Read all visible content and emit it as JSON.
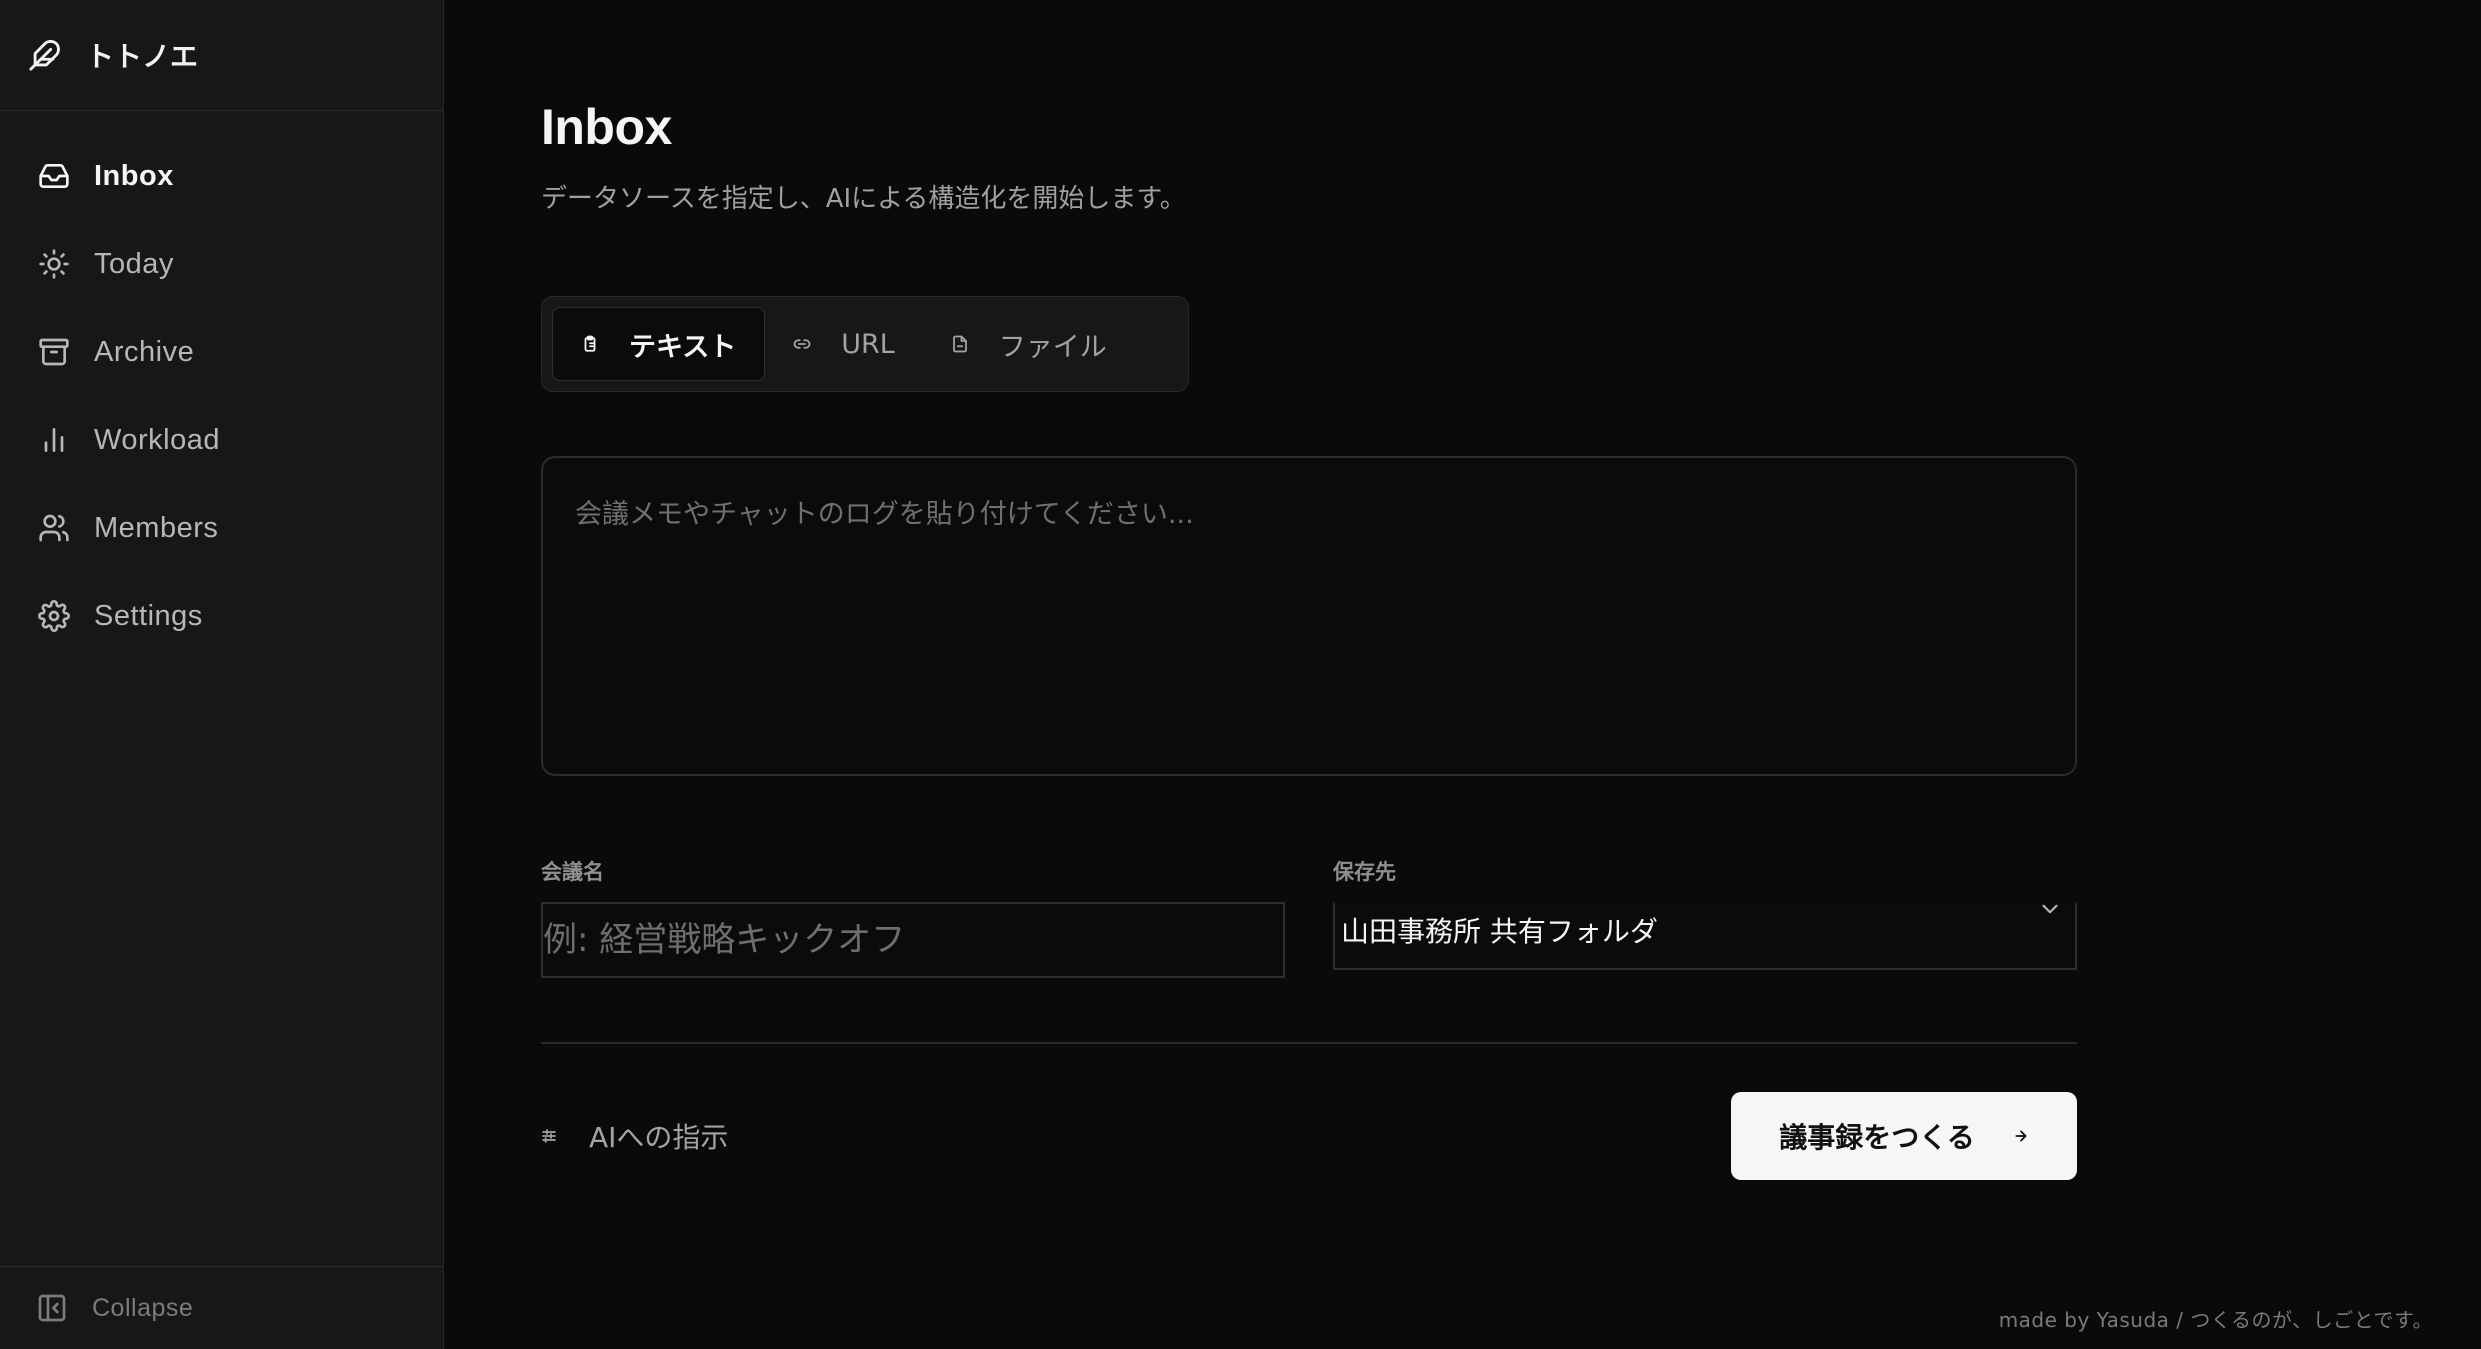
{
  "app": {
    "name": "トトノエ"
  },
  "sidebar": {
    "items": [
      {
        "label": "Inbox",
        "icon": "inbox-icon",
        "active": true
      },
      {
        "label": "Today",
        "icon": "sun-icon",
        "active": false
      },
      {
        "label": "Archive",
        "icon": "archive-icon",
        "active": false
      },
      {
        "label": "Workload",
        "icon": "bar-chart-icon",
        "active": false
      },
      {
        "label": "Members",
        "icon": "users-icon",
        "active": false
      },
      {
        "label": "Settings",
        "icon": "gear-icon",
        "active": false
      }
    ],
    "collapse_label": "Collapse"
  },
  "page": {
    "title": "Inbox",
    "subtitle": "データソースを指定し、AIによる構造化を開始します。"
  },
  "source_tabs": [
    {
      "label": "テキスト",
      "icon": "clipboard-icon",
      "active": true
    },
    {
      "label": "URL",
      "icon": "link-icon",
      "active": false
    },
    {
      "label": "ファイル",
      "icon": "file-icon",
      "active": false
    }
  ],
  "input": {
    "placeholder": "会議メモやチャットのログを貼り付けてください...",
    "value": ""
  },
  "meeting": {
    "label": "会議名",
    "placeholder": "例: 経営戦略キックオフ",
    "value": ""
  },
  "destination": {
    "label": "保存先",
    "value": "山田事務所 共有フォルダ"
  },
  "ai_instructions": {
    "label": "AIへの指示",
    "icon": "sliders-icon"
  },
  "submit": {
    "label": "議事録をつくる",
    "icon": "arrow-right-icon"
  },
  "footer": {
    "credit": "made by Yasuda / つくるのが、しごとです。"
  },
  "colors": {
    "background": "#0a0a0a",
    "sidebar": "#171717",
    "primary_button": "#f6f6f6"
  }
}
